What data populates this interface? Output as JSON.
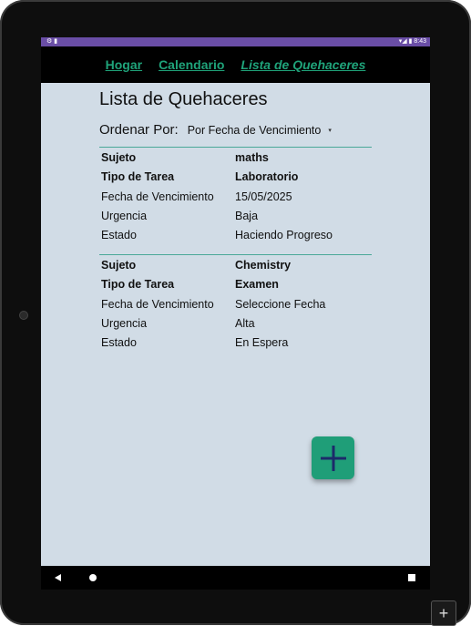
{
  "status_bar": {
    "left_icons": "⚙ ▮",
    "right_text": "▾◢ ▮ 8:43"
  },
  "nav": {
    "home": "Hogar",
    "calendar": "Calendario",
    "tasks": "Lista de Quehaceres"
  },
  "page": {
    "title": "Lista de Quehaceres",
    "sort_label": "Ordenar Por:",
    "sort_value": "Por Fecha de Vencimiento",
    "sort_caret": "▾"
  },
  "tasks": [
    {
      "rows": [
        {
          "key": "Sujeto",
          "value": "maths"
        },
        {
          "key": "Tipo de Tarea",
          "value": "Laboratorio"
        },
        {
          "key": "Fecha de Vencimiento",
          "value": "15/05/2025"
        },
        {
          "key": "Urgencia",
          "value": "Baja"
        },
        {
          "key": "Estado",
          "value": "Haciendo Progreso"
        }
      ]
    },
    {
      "rows": [
        {
          "key": "Sujeto",
          "value": "Chemistry"
        },
        {
          "key": "Tipo de Tarea",
          "value": "Examen"
        },
        {
          "key": "Fecha de Vencimiento",
          "value": "Seleccione Fecha"
        },
        {
          "key": "Urgencia",
          "value": "Alta"
        },
        {
          "key": "Estado",
          "value": "En Espera"
        }
      ]
    }
  ],
  "fab": {
    "icon": "plus-icon"
  },
  "corner_button": {
    "label": "+"
  },
  "colors": {
    "accent": "#1fa37a",
    "fab": "#1f9e78",
    "content_bg": "#d1dce6",
    "statusbar": "#6a4ea6",
    "divider": "#4aa898"
  }
}
